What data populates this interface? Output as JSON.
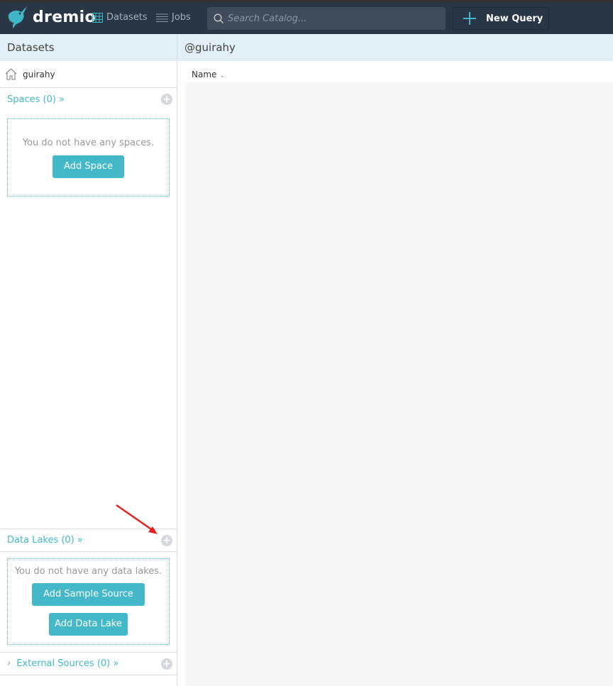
{
  "header": {
    "logo": "dremio",
    "nav": [
      {
        "label": "Datasets",
        "icon": "grid-icon"
      },
      {
        "label": "Jobs",
        "icon": "list-icon"
      }
    ],
    "search_placeholder": "Search Catalog...",
    "new_query": "New Query"
  },
  "sidebar": {
    "title": "Datasets",
    "home": "guirahy",
    "spaces": {
      "label": "Spaces (0) »",
      "empty": "You do not have any spaces.",
      "button": "Add Space"
    },
    "data_lakes": {
      "label": "Data Lakes (0) »",
      "empty": "You do not have any data lakes.",
      "buttons": [
        "Add Sample Source",
        "Add Data Lake"
      ]
    },
    "external": {
      "label": "External Sources (0) »"
    }
  },
  "main": {
    "title": "@guirahy",
    "column": "Name"
  },
  "colors": {
    "accent": "#43b8c9",
    "header_bg": "#283646",
    "annotation": "#e8201c"
  }
}
